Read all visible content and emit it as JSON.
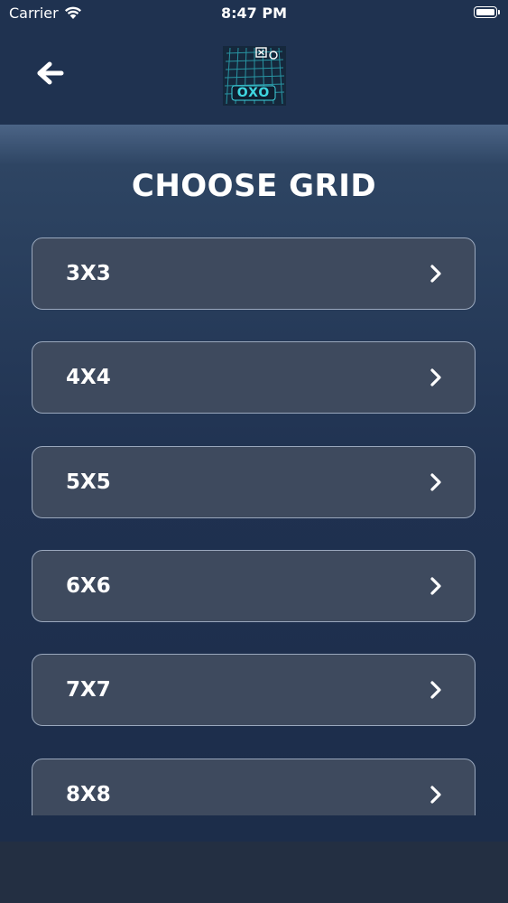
{
  "status_bar": {
    "carrier": "Carrier",
    "time": "8:47 PM"
  },
  "nav": {
    "back_icon": "arrow-left-icon",
    "logo_text": "OXO"
  },
  "page": {
    "title": "CHOOSE GRID"
  },
  "grid_options": [
    {
      "label": "3X3"
    },
    {
      "label": "4X4"
    },
    {
      "label": "5X5"
    },
    {
      "label": "6X6"
    },
    {
      "label": "7X7"
    },
    {
      "label": "8X8"
    }
  ],
  "colors": {
    "background": "#1f3250",
    "option_fill": "#3e4a5e",
    "option_border": "#9aa8bd",
    "logo_accent": "#3fd6e0"
  }
}
